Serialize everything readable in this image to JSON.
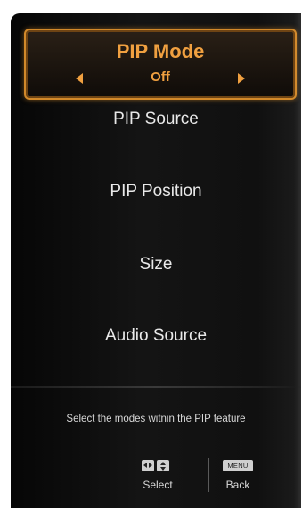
{
  "menu": {
    "selected": {
      "title": "PIP Mode",
      "value": "Off"
    },
    "items": [
      "PIP Source",
      "PIP Position",
      "Size",
      "Audio Source"
    ]
  },
  "help_text": "Select the modes witnin the PIP feature",
  "hints": {
    "select_label": "Select",
    "menu_key_label": "MENU",
    "back_label": "Back"
  },
  "icons": [
    "left-arrow-icon",
    "right-arrow-icon",
    "left-right-key-icon",
    "up-down-key-icon"
  ],
  "colors": {
    "accent": "#f0a040",
    "border": "#d2892a",
    "text": "#e9e9e9"
  }
}
